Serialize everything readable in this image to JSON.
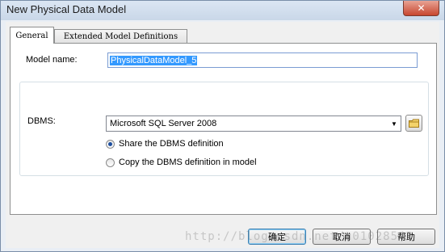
{
  "window": {
    "title": "New Physical Data Model",
    "close_glyph": "✕"
  },
  "tabs": [
    {
      "label": "General",
      "active": true
    },
    {
      "label": "Extended Model Definitions",
      "active": false
    }
  ],
  "general": {
    "model_name_label": "Model name:",
    "model_name_value": "PhysicalDataModel_5",
    "dbms_label": "DBMS:",
    "dbms_selected": "Microsoft SQL Server 2008",
    "radio_options": [
      {
        "label": "Share the DBMS definition",
        "checked": true
      },
      {
        "label": "Copy the DBMS definition in model",
        "checked": false
      }
    ]
  },
  "buttons": {
    "ok": "确定",
    "cancel": "取消",
    "help": "帮助"
  },
  "watermark": "http://blog.csdn.net/u01028542",
  "icons": {
    "close": "close-icon",
    "dropdown": "chevron-down-icon",
    "browse": "folder-icon"
  }
}
